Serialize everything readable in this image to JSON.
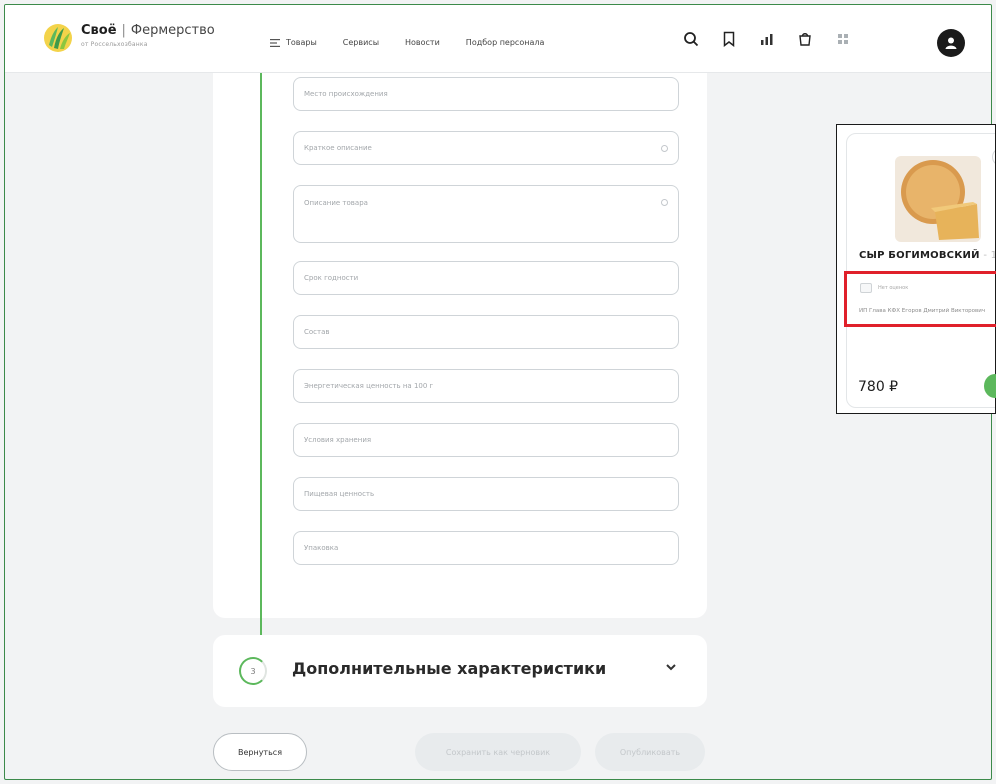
{
  "header": {
    "brand": "Своё",
    "separator": "|",
    "product": "Фермерство",
    "subtitle": "от Россельхозбанка",
    "nav": [
      {
        "label": "Товары",
        "icon": "menu-icon"
      },
      {
        "label": "Сервисы"
      },
      {
        "label": "Новости"
      },
      {
        "label": "Подбор персонала"
      }
    ],
    "icons": [
      "search-icon",
      "bookmark-icon",
      "chart-icon",
      "cart-icon",
      "grid-icon",
      "user-icon"
    ]
  },
  "form": {
    "fields": [
      {
        "placeholder": "Место происхождения"
      },
      {
        "placeholder": "Краткое описание"
      },
      {
        "placeholder": "Описание товара"
      },
      {
        "placeholder": "Срок годности"
      },
      {
        "placeholder": "Состав"
      },
      {
        "placeholder": "Энергетическая ценность на 100 г"
      },
      {
        "placeholder": "Условия хранения"
      },
      {
        "placeholder": "Пищевая ценность"
      },
      {
        "placeholder": "Упаковка"
      }
    ]
  },
  "additional": {
    "step_number": "3",
    "title": "Дополнительные характеристики"
  },
  "buttons": {
    "back": "Вернуться",
    "save": "Сохранить как черновик",
    "publish": "Опубликовать"
  },
  "preview": {
    "product_name": "СЫР БОГИМОВСКИЙ",
    "name_suffix": "- 1",
    "rating_text": "Нет оценок",
    "seller": "ИП Глава КФХ Егоров Дмитрий Викторович",
    "price": "780 ₽"
  },
  "colors": {
    "accent": "#5cb85c",
    "highlight": "#e0202a",
    "frame": "#3c8a4a"
  }
}
